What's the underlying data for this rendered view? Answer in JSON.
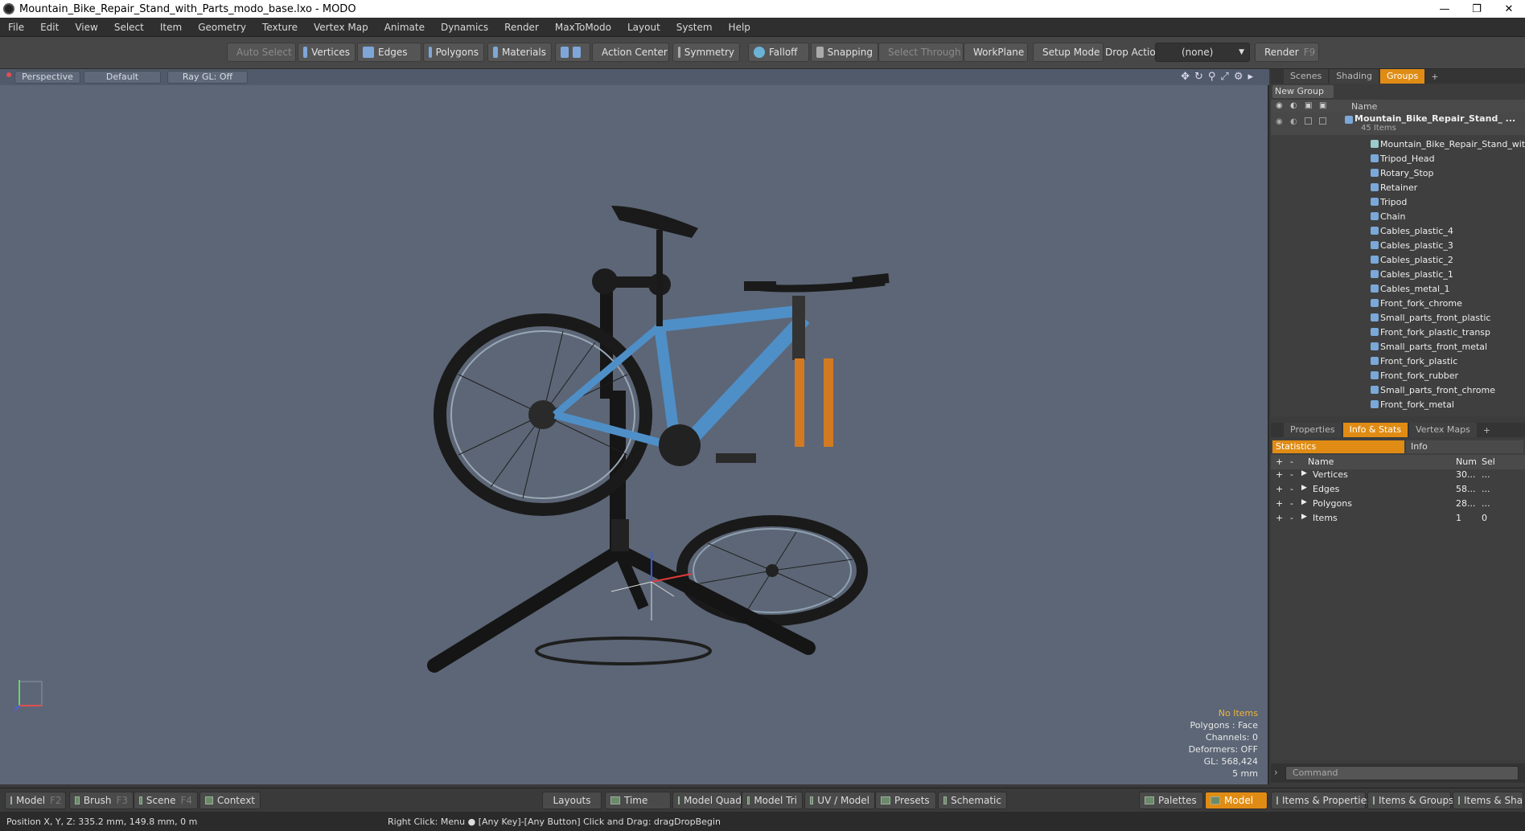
{
  "title": "Mountain_Bike_Repair_Stand_with_Parts_modo_base.lxo - MODO",
  "menu": [
    "File",
    "Edit",
    "View",
    "Select",
    "Item",
    "Geometry",
    "Texture",
    "Vertex Map",
    "Animate",
    "Dynamics",
    "Render",
    "MaxToModo",
    "Layout",
    "System",
    "Help"
  ],
  "toolbar": {
    "auto_select": "Auto Select",
    "vertices": "Vertices",
    "edges": "Edges",
    "polygons": "Polygons",
    "materials": "Materials",
    "action_center": "Action Center",
    "symmetry": "Symmetry",
    "falloff": "Falloff",
    "snapping": "Snapping",
    "select_through": "Select Through",
    "workplane": "WorkPlane",
    "setup_mode": "Setup Mode",
    "drop_action": "Drop Action",
    "drop_value": "(none)",
    "render": "Render",
    "render_key": "F9"
  },
  "viewport": {
    "view": "Perspective",
    "style": "Default",
    "raygl": "Ray GL: Off"
  },
  "stats": {
    "items": "No Items",
    "polygons": "Polygons : Face",
    "channels": "Channels: 0",
    "deformers": "Deformers: OFF",
    "gl": "GL: 568,424",
    "unit": "5 mm"
  },
  "top_tabs": [
    "Scenes",
    "Shading",
    "Groups"
  ],
  "new_group": "New Group",
  "group_header": "Name",
  "root_group": {
    "name": "Mountain_Bike_Repair_Stand_ ...",
    "count": "45 Items"
  },
  "groups": [
    "Mountain_Bike_Repair_Stand_with ...",
    "Tripod_Head",
    "Rotary_Stop",
    "Retainer",
    "Tripod",
    "Chain",
    "Cables_plastic_4",
    "Cables_plastic_3",
    "Cables_plastic_2",
    "Cables_plastic_1",
    "Cables_metal_1",
    "Front_fork_chrome",
    "Small_parts_front_plastic",
    "Front_fork_plastic_transp",
    "Small_parts_front_metal",
    "Front_fork_plastic",
    "Front_fork_rubber",
    "Small_parts_front_chrome",
    "Front_fork_metal"
  ],
  "mid_tabs": [
    "Properties",
    "Info & Stats",
    "Vertex Maps"
  ],
  "stat_tabs": [
    "Statistics",
    "Info"
  ],
  "stat_header": {
    "name": "Name",
    "num": "Num",
    "sel": "Sel"
  },
  "stat_rows": [
    {
      "name": "Vertices",
      "num": "30...",
      "sel": "..."
    },
    {
      "name": "Edges",
      "num": "58...",
      "sel": "..."
    },
    {
      "name": "Polygons",
      "num": "28...",
      "sel": "..."
    },
    {
      "name": "Items",
      "num": "1",
      "sel": "0"
    }
  ],
  "command_placeholder": "Command",
  "bottom": {
    "model": "Model",
    "model_key": "F2",
    "brush": "Brush",
    "brush_key": "F3",
    "scene": "Scene",
    "scene_key": "F4",
    "context": "Context",
    "layouts": "Layouts",
    "time": "Time",
    "model_quad": "Model Quad",
    "model_tri": "Model Tri",
    "uv_model": "UV / Model",
    "presets": "Presets",
    "schematic": "Schematic",
    "palettes": "Palettes",
    "model_active": "Model",
    "items_props": "Items & Properties",
    "items_groups": "Items & Groups",
    "items_shading": "Items & Shadi"
  },
  "status": {
    "position": "Position X, Y, Z:   335.2 mm, 149.8 mm, 0 m",
    "hint": "Right Click: Menu ● [Any Key]-[Any Button] Click and Drag: dragDropBegin"
  }
}
